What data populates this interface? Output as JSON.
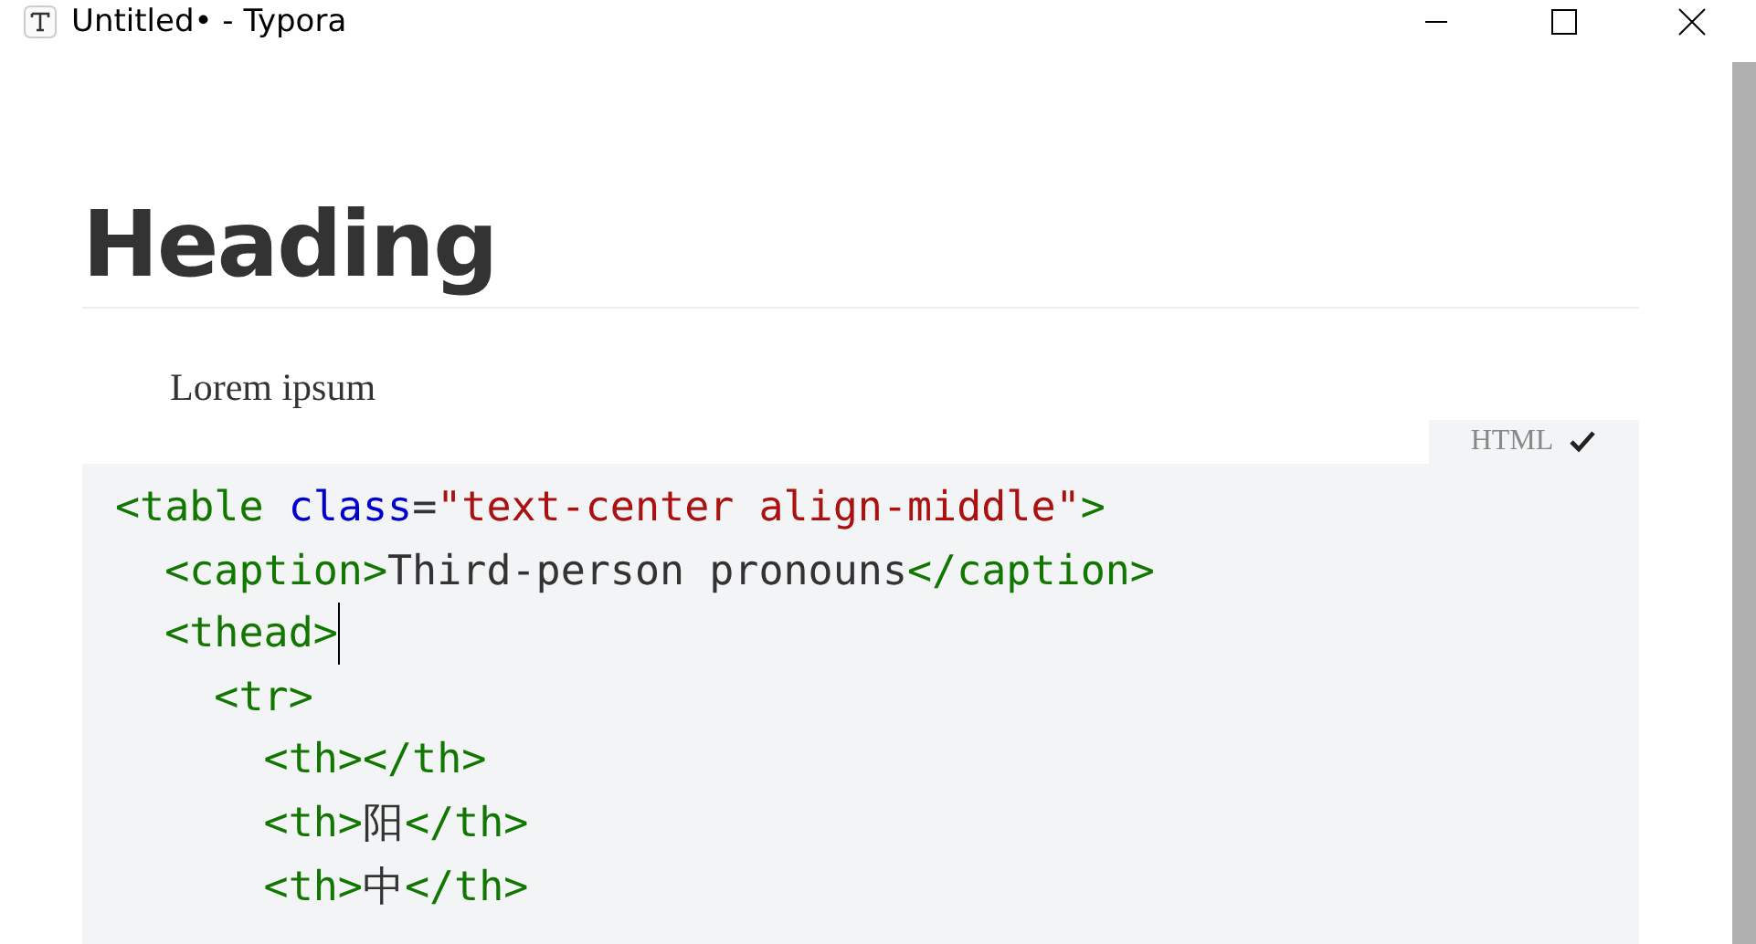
{
  "window": {
    "title": "Untitled• - Typora"
  },
  "document": {
    "heading": "Heading",
    "paragraph": "Lorem ipsum",
    "code_block": {
      "language": "HTML",
      "lines": [
        {
          "caret": false,
          "tokens": [
            {
              "kind": "tag",
              "text": "<table "
            },
            {
              "kind": "attr",
              "text": "class"
            },
            {
              "kind": "punct",
              "text": "="
            },
            {
              "kind": "string",
              "text": "\"text-center align-middle\""
            },
            {
              "kind": "tag",
              "text": ">"
            }
          ]
        },
        {
          "caret": false,
          "tokens": [
            {
              "kind": "tag",
              "text": "  <caption>"
            },
            {
              "kind": "text",
              "text": "Third-person pronouns"
            },
            {
              "kind": "tag",
              "text": "</caption>"
            }
          ]
        },
        {
          "caret": true,
          "tokens": [
            {
              "kind": "tag",
              "text": "  <thead>"
            }
          ]
        },
        {
          "caret": false,
          "tokens": [
            {
              "kind": "tag",
              "text": "    <tr>"
            }
          ]
        },
        {
          "caret": false,
          "tokens": [
            {
              "kind": "tag",
              "text": "      <th></th>"
            }
          ]
        },
        {
          "caret": false,
          "tokens": [
            {
              "kind": "tag",
              "text": "      <th>"
            },
            {
              "kind": "text",
              "text": "阳"
            },
            {
              "kind": "tag",
              "text": "</th>"
            }
          ]
        },
        {
          "caret": false,
          "tokens": [
            {
              "kind": "tag",
              "text": "      <th>"
            },
            {
              "kind": "text",
              "text": "中"
            },
            {
              "kind": "tag",
              "text": "</th>"
            }
          ]
        }
      ]
    }
  }
}
